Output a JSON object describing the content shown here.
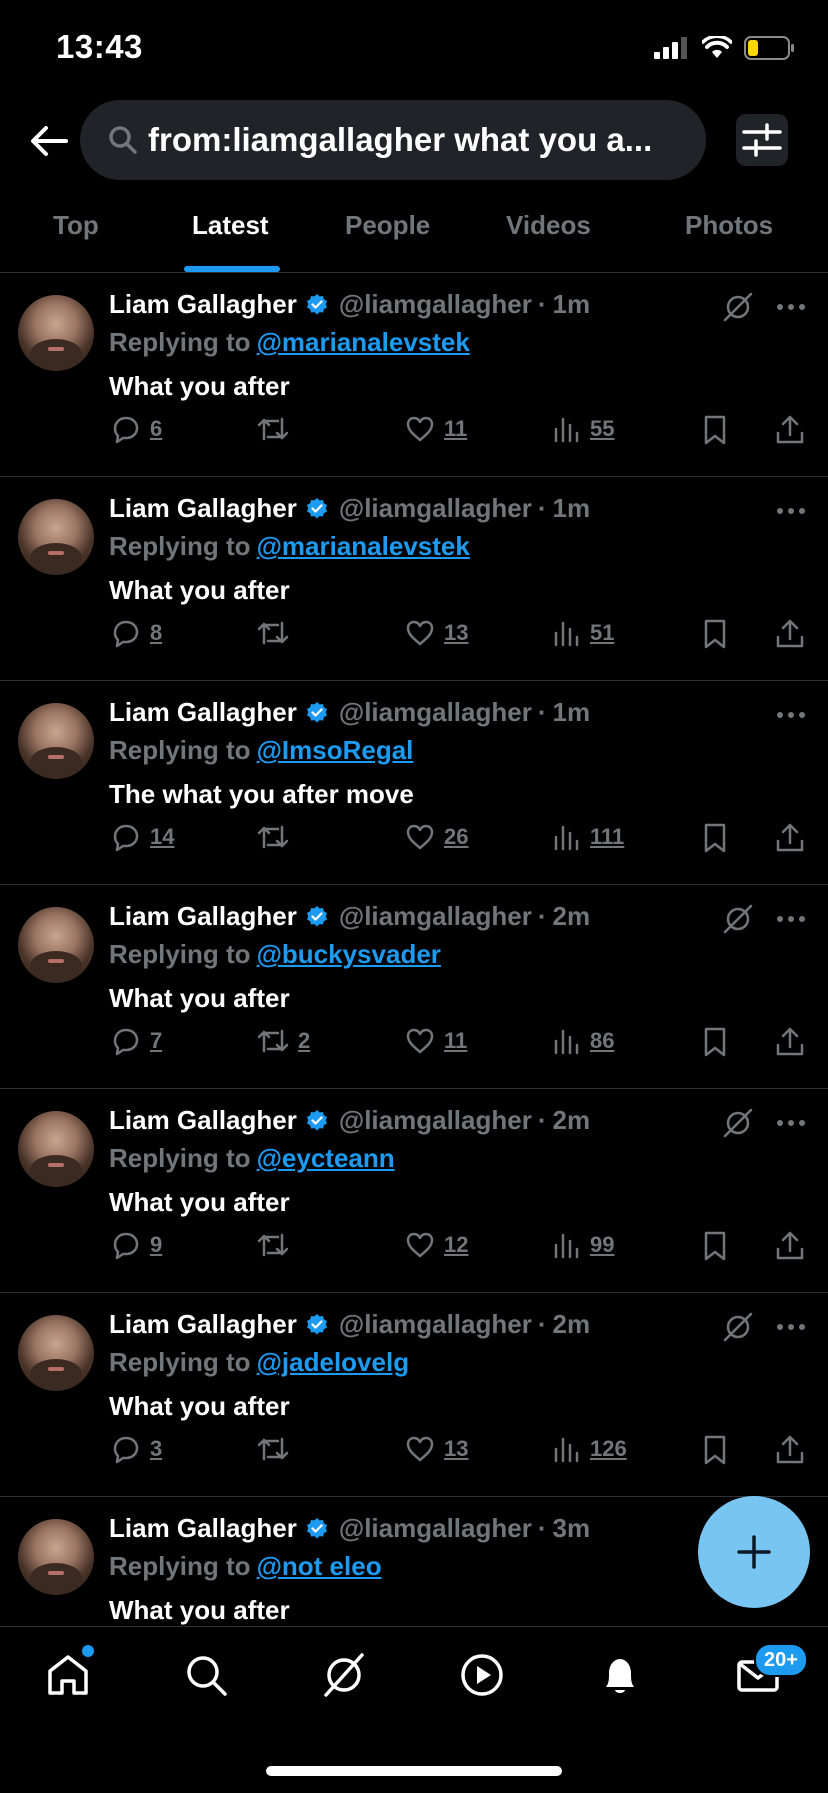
{
  "status_bar": {
    "time": "13:43"
  },
  "search": {
    "query": "from:liamgallagher what you a..."
  },
  "tabs": [
    {
      "label": "Top"
    },
    {
      "label": "Latest"
    },
    {
      "label": "People"
    },
    {
      "label": "Videos"
    },
    {
      "label": "Photos"
    }
  ],
  "active_tab": "Latest",
  "tweets": [
    {
      "name": "Liam Gallagher",
      "handle": "@liamgallagher",
      "age": "1m",
      "replying_label": "Replying to",
      "replying_to": "@marianalevstek",
      "text": "What you after",
      "replies": "6",
      "retweets": "",
      "likes": "11",
      "views": "55",
      "grok_icon": true
    },
    {
      "name": "Liam Gallagher",
      "handle": "@liamgallagher",
      "age": "1m",
      "replying_label": "Replying to",
      "replying_to": "@marianalevstek",
      "text": "What you after",
      "replies": "8",
      "retweets": "",
      "likes": "13",
      "views": "51",
      "grok_icon": false
    },
    {
      "name": "Liam Gallagher",
      "handle": "@liamgallagher",
      "age": "1m",
      "replying_label": "Replying to",
      "replying_to": "@ImsoRegal",
      "text": "The what you after move",
      "replies": "14",
      "retweets": "",
      "likes": "26",
      "views": "111",
      "grok_icon": false
    },
    {
      "name": "Liam Gallagher",
      "handle": "@liamgallagher",
      "age": "2m",
      "replying_label": "Replying to",
      "replying_to": "@buckysvader",
      "text": "What you after",
      "replies": "7",
      "retweets": "2",
      "likes": "11",
      "views": "86",
      "grok_icon": true
    },
    {
      "name": "Liam Gallagher",
      "handle": "@liamgallagher",
      "age": "2m",
      "replying_label": "Replying to",
      "replying_to": "@eycteann",
      "text": "What you after",
      "replies": "9",
      "retweets": "",
      "likes": "12",
      "views": "99",
      "grok_icon": true
    },
    {
      "name": "Liam Gallagher",
      "handle": "@liamgallagher",
      "age": "2m",
      "replying_label": "Replying to",
      "replying_to": "@jadelovelg",
      "text": "What you after",
      "replies": "3",
      "retweets": "",
      "likes": "13",
      "views": "126",
      "grok_icon": true
    },
    {
      "name": "Liam Gallagher",
      "handle": "@liamgallagher",
      "age": "3m",
      "replying_label": "Replying to",
      "replying_to": "@not eleo",
      "text": "What you after",
      "replies": "",
      "retweets": "",
      "likes": "",
      "views": "",
      "grok_icon": false
    }
  ],
  "bottom_nav": {
    "items": [
      "home-icon",
      "search-icon",
      "grok-icon",
      "play-icon",
      "bell-icon",
      "mail-icon"
    ],
    "messages_badge": "20+"
  },
  "colors": {
    "accent": "#1d9bf0",
    "fab": "#79c5f2",
    "muted": "#71767b",
    "background": "#000000"
  }
}
